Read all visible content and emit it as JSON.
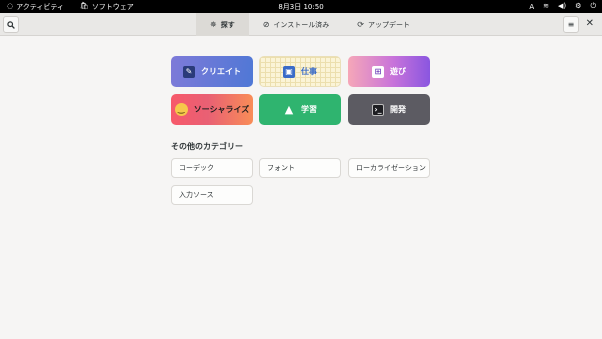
{
  "topbar": {
    "activities": "アクティビティ",
    "app_name": "ソフトウェア",
    "clock": "8月3日  10:50",
    "input_method": "A"
  },
  "header": {
    "tabs": [
      {
        "label": "探す",
        "icon": "explore-icon"
      },
      {
        "label": "インストール済み",
        "icon": "check-circle-icon"
      },
      {
        "label": "アップデート",
        "icon": "refresh-icon"
      }
    ]
  },
  "categories": {
    "create": "クリエイト",
    "work": "仕事",
    "play": "遊び",
    "socialize": "ソーシャライズ",
    "learn": "学習",
    "develop": "開発"
  },
  "other": {
    "title": "その他のカテゴリー",
    "items": [
      "コーデック",
      "フォント",
      "ローカライゼーション",
      "入力ソース"
    ]
  },
  "colors": {
    "create_tile": "#5f78d6",
    "play_tile": "#c873da",
    "social_tile": "#f7596a",
    "learn_tile": "#2fb46f",
    "develop_tile": "#5c5b62"
  }
}
